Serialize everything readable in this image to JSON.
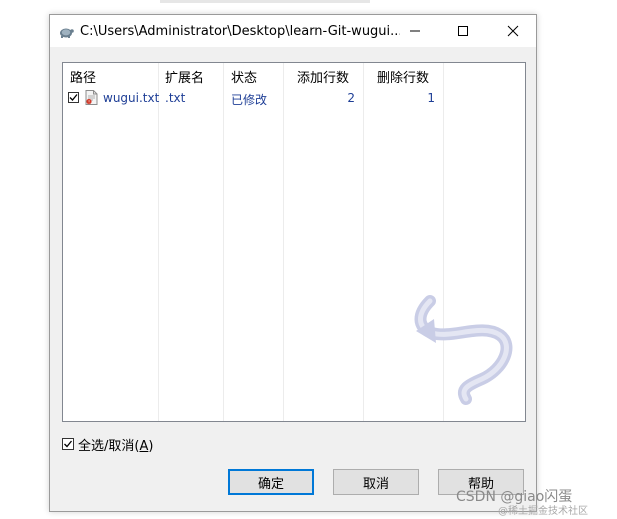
{
  "window": {
    "title": "C:\\Users\\Administrator\\Desktop\\learn-Git-wugui...",
    "icons": {
      "app": "tortoise-app-icon",
      "minimize": "minimize-icon",
      "maximize": "maximize-icon",
      "close": "close-icon"
    }
  },
  "list": {
    "columns": [
      "路径",
      "扩展名",
      "状态",
      "添加行数",
      "删除行数"
    ],
    "rows": [
      {
        "checked": true,
        "path": "wugui.txt",
        "extension": ".txt",
        "status": "已修改",
        "lines_added": "2",
        "lines_removed": "1",
        "icon": "text-file-modified-icon"
      }
    ],
    "text_color": "#1e3e96"
  },
  "select_all": {
    "checked": true,
    "label_prefix": "全选/取消(",
    "label_key": "A",
    "label_suffix": ")"
  },
  "buttons": {
    "ok": "确定",
    "cancel": "取消",
    "help": "帮助"
  },
  "watermark": {
    "line1": "CSDN @giao闪蛋",
    "line2": "@稀土掘金技术社区"
  }
}
